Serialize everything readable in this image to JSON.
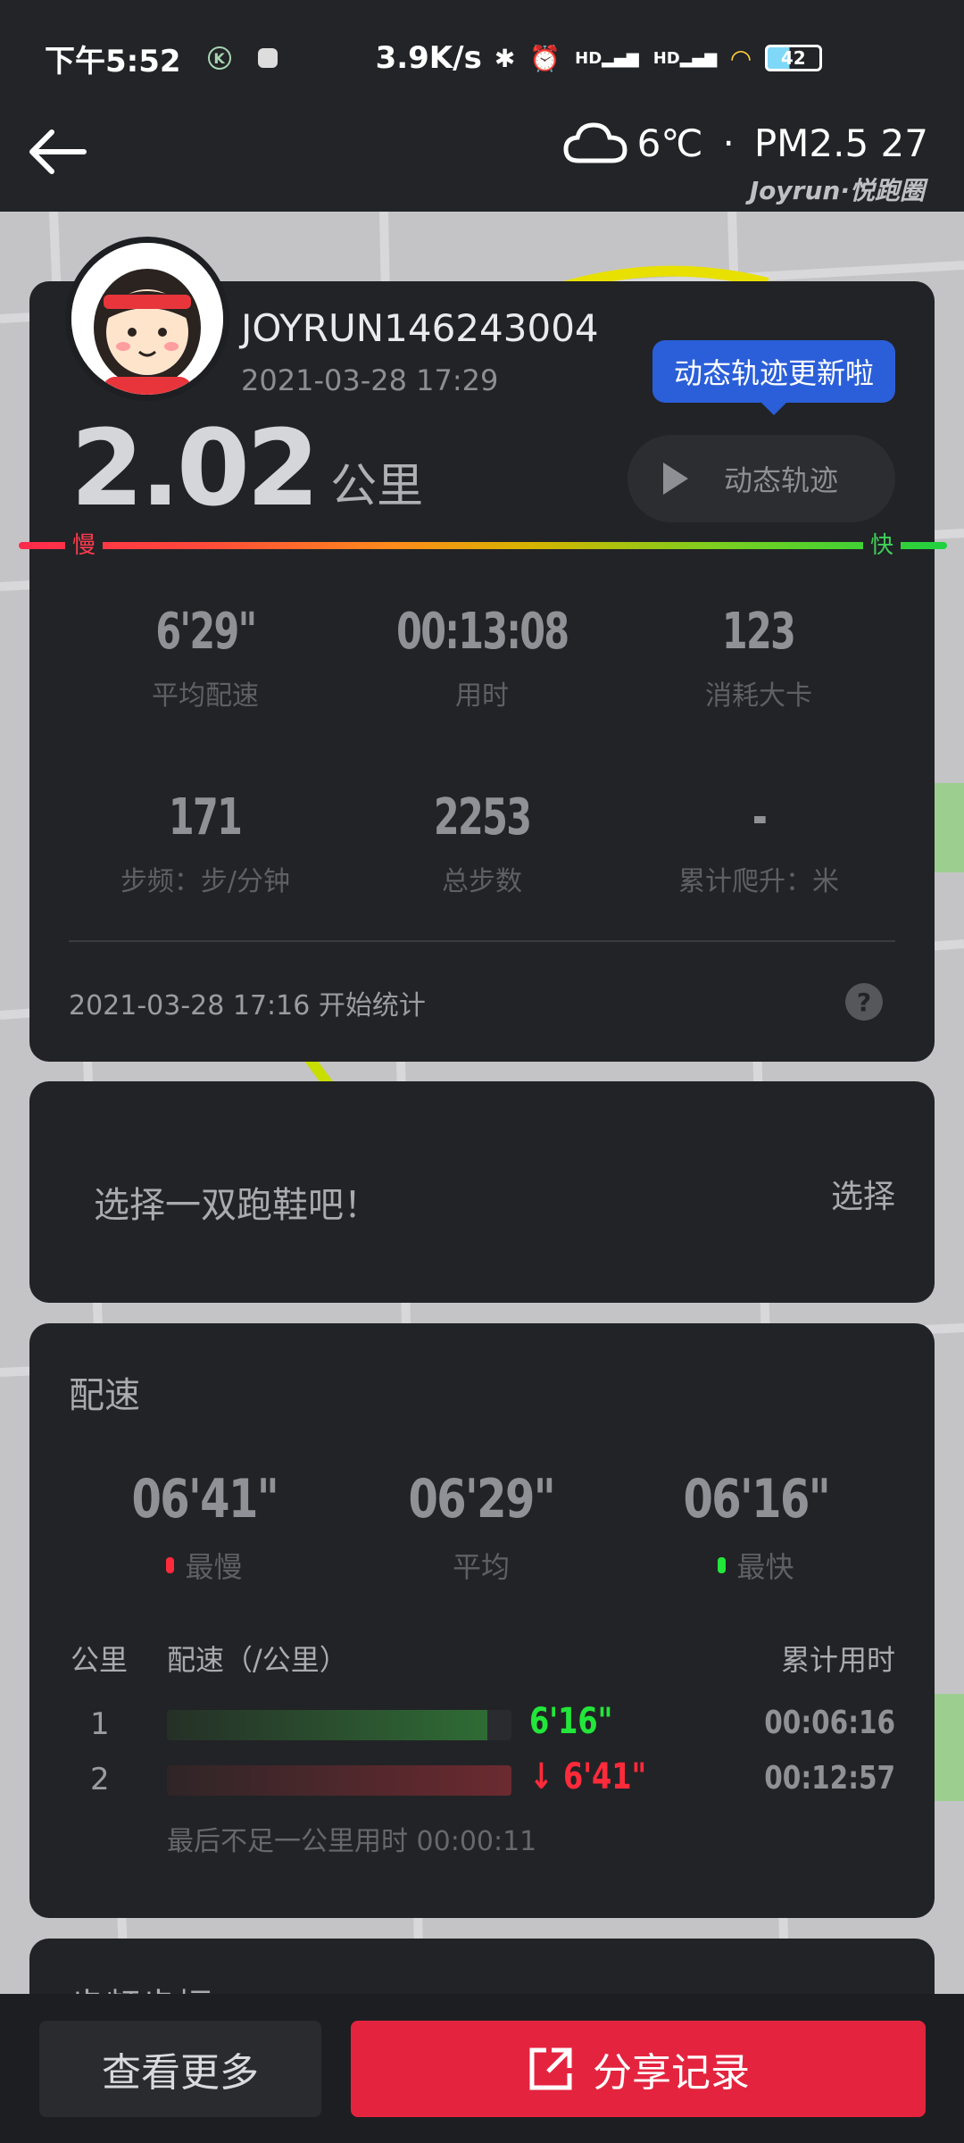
{
  "status_bar": {
    "time": "下午5:52",
    "k_badge": "K",
    "net_speed": "3.9K/s",
    "hd1": "HD",
    "hd2": "HD",
    "battery": "42"
  },
  "header": {
    "weather_temp": "6℃",
    "weather_sep": "·",
    "weather_pm": "PM2.5 27",
    "brand": "Joyrun·悦跑圈"
  },
  "summary": {
    "username": "JOYRUN146243004",
    "run_datetime": "2021-03-28 17:29",
    "tooltip": "动态轨迹更新啦",
    "distance": "2.02",
    "distance_unit": "公里",
    "replay_label": "动态轨迹",
    "slow_label": "慢",
    "fast_label": "快",
    "stats": [
      {
        "value": "6'29\"",
        "label": "平均配速"
      },
      {
        "value": "00:13:08",
        "label": "用时"
      },
      {
        "value": "123",
        "label": "消耗大卡"
      },
      {
        "value": "171",
        "label": "步频：步/分钟"
      },
      {
        "value": "2253",
        "label": "总步数"
      },
      {
        "value": "-",
        "label": "累计爬升：米"
      }
    ],
    "start_text": "2021-03-28 17:16  开始统计",
    "help": "?"
  },
  "shoe": {
    "prompt": "选择一双跑鞋吧！",
    "select_label": "选择"
  },
  "pace": {
    "title": "配速",
    "slowest": {
      "value": "06'41\"",
      "label": "最慢"
    },
    "average": {
      "value": "06'29\"",
      "label": "平均"
    },
    "fastest": {
      "value": "06'16\"",
      "label": "最快"
    },
    "col_km": "公里",
    "col_pace": "配速（/公里）",
    "col_cum": "累计用时",
    "rows": [
      {
        "km": "1",
        "pace": "6'16\"",
        "cumulative": "00:06:16",
        "fill": 0.93
      },
      {
        "km": "2",
        "pace": "↓ 6'41\"",
        "cumulative": "00:12:57",
        "fill": 1.0
      }
    ],
    "last_km_note": "最后不足一公里用时 00:00:11"
  },
  "next_section": {
    "title": "步频步幅"
  },
  "bottom": {
    "more_label": "查看更多",
    "share_label": "分享记录"
  },
  "colors": {
    "accent_red": "#e4243f",
    "tooltip_blue": "#2b5fd9",
    "fast_green": "#22e63a",
    "slow_red": "#ff2a3a"
  }
}
